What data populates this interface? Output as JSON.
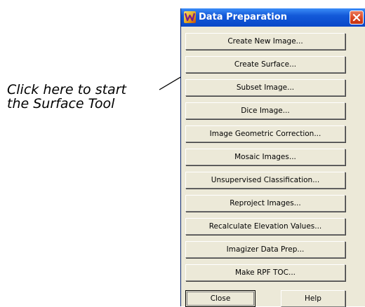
{
  "callout": {
    "line1": "Click here to start",
    "line2": "the Surface Tool"
  },
  "window": {
    "title": "Data Preparation",
    "app_icon": "imagine-app-icon",
    "close_icon": "close-icon"
  },
  "menu_buttons": [
    {
      "label": "Create New Image..."
    },
    {
      "label": "Create Surface..."
    },
    {
      "label": "Subset Image..."
    },
    {
      "label": "Dice Image..."
    },
    {
      "label": "Image Geometric Correction..."
    },
    {
      "label": "Mosaic Images..."
    },
    {
      "label": "Unsupervised Classification..."
    },
    {
      "label": "Reproject Images..."
    },
    {
      "label": "Recalculate Elevation Values..."
    },
    {
      "label": "Imagizer Data Prep..."
    },
    {
      "label": "Make RPF TOC..."
    }
  ],
  "footer": {
    "close_label": "Close",
    "help_label": "Help"
  },
  "colors": {
    "titlebar": "#0847c8",
    "close_button": "#d9431f",
    "dialog_bg": "#ece9d8"
  }
}
